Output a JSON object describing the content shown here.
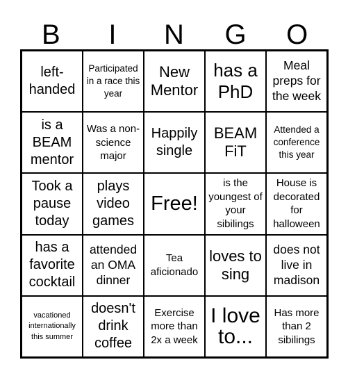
{
  "header": {
    "letters": [
      "B",
      "I",
      "N",
      "G",
      "O"
    ]
  },
  "board": {
    "cells": [
      "left-handed",
      "Participated in a race this year",
      "New Mentor",
      "has a PhD",
      "Meal preps for the week",
      "is a BEAM mentor",
      "Was a non-science major",
      "Happily single",
      "BEAM FiT",
      "Attended a conference this year",
      "Took a pause today",
      "plays video games",
      "Free!",
      "is the youngest of your sibilings",
      "House is decorated for halloween",
      "has a favorite cocktail",
      "attended an OMA dinner",
      "Tea aficionado",
      "loves to sing",
      "does not live in madison",
      "vacationed internationally this summer",
      "doesn't drink coffee",
      "Exercise more than 2x a week",
      "I love to...",
      "Has more than 2 sibilings"
    ]
  }
}
